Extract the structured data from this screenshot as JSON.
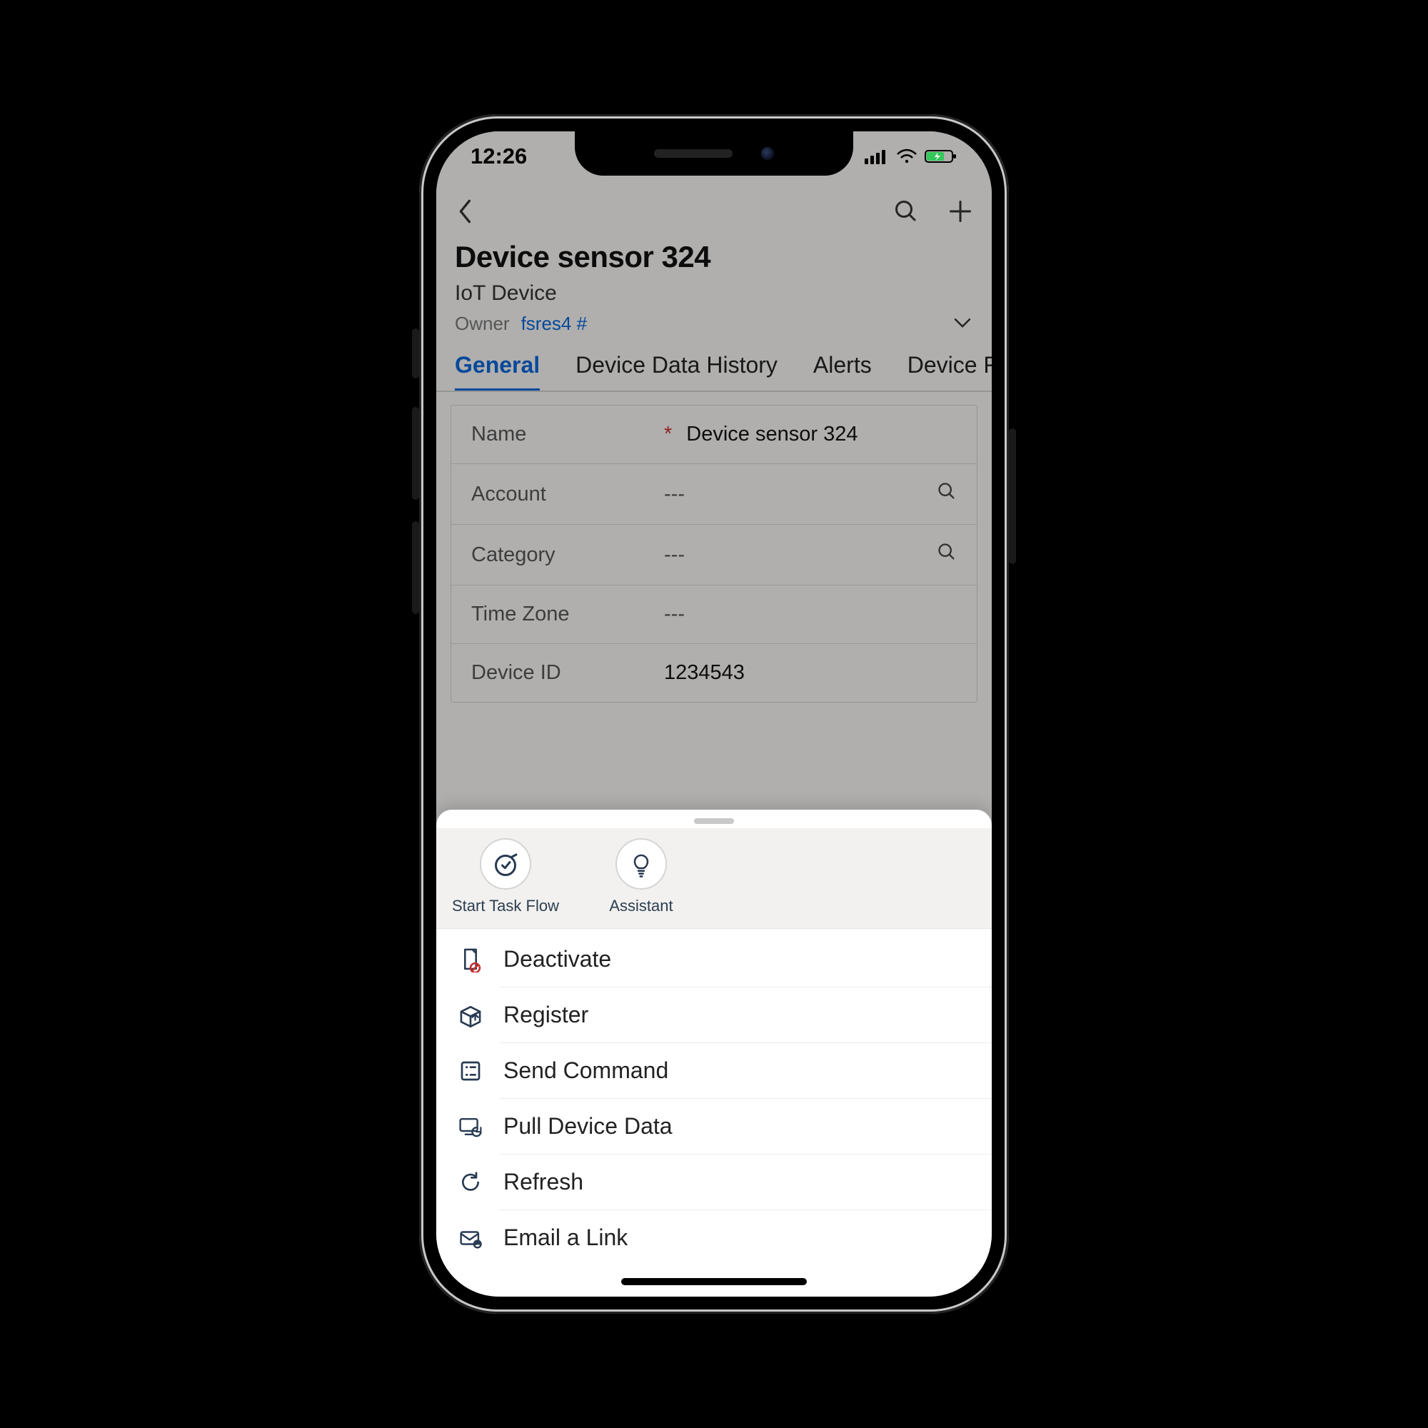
{
  "status_bar": {
    "time": "12:26"
  },
  "header": {
    "title": "Device sensor 324",
    "type": "IoT Device",
    "owner_label": "Owner",
    "owner_value": "fsres4 #"
  },
  "tabs": [
    {
      "label": "General",
      "active": true
    },
    {
      "label": "Device Data History"
    },
    {
      "label": "Alerts"
    },
    {
      "label": "Device R"
    }
  ],
  "fields": {
    "name": {
      "label": "Name",
      "value": "Device sensor 324",
      "required": true
    },
    "account": {
      "label": "Account",
      "value": "---",
      "lookup": true
    },
    "category": {
      "label": "Category",
      "value": "---",
      "lookup": true
    },
    "timezone": {
      "label": "Time Zone",
      "value": "---"
    },
    "device_id": {
      "label": "Device ID",
      "value": "1234543"
    }
  },
  "sheet": {
    "shortcuts": [
      {
        "key": "start_task_flow",
        "label": "Start Task Flow"
      },
      {
        "key": "assistant",
        "label": "Assistant"
      }
    ],
    "actions": [
      {
        "key": "deactivate",
        "label": "Deactivate"
      },
      {
        "key": "register",
        "label": "Register"
      },
      {
        "key": "send_command",
        "label": "Send Command"
      },
      {
        "key": "pull_device_data",
        "label": "Pull Device Data"
      },
      {
        "key": "refresh",
        "label": "Refresh"
      },
      {
        "key": "email_a_link",
        "label": "Email a Link"
      }
    ]
  }
}
